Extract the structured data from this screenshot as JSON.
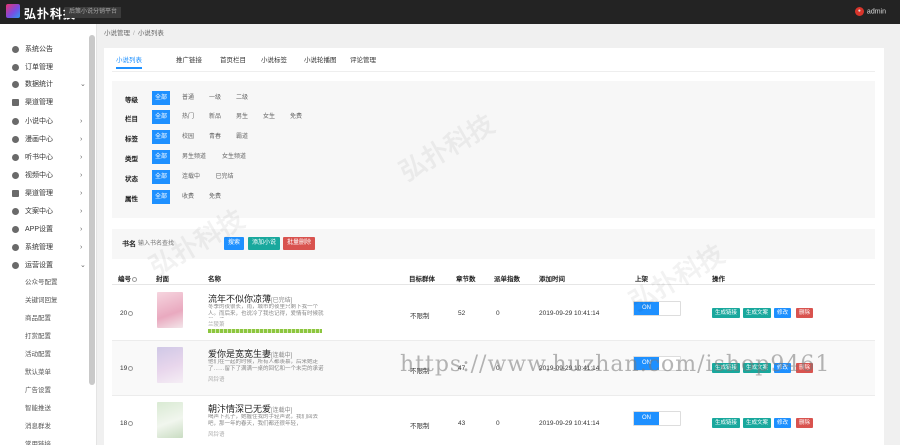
{
  "header": {
    "brand": "弘扑科技",
    "slogan": "后策小说分销平台",
    "user": "admin"
  },
  "sidebar": {
    "items": [
      {
        "label": "系统公告",
        "arrow": ""
      },
      {
        "label": "订单管理",
        "arrow": ""
      },
      {
        "label": "数据统计",
        "arrow": "⌄"
      },
      {
        "label": "渠道管理",
        "arrow": ""
      },
      {
        "label": "小说中心",
        "arrow": "›"
      },
      {
        "label": "漫画中心",
        "arrow": "›"
      },
      {
        "label": "听书中心",
        "arrow": "›"
      },
      {
        "label": "视频中心",
        "arrow": "›"
      },
      {
        "label": "渠道管理",
        "arrow": "›"
      },
      {
        "label": "文案中心",
        "arrow": "›"
      },
      {
        "label": "APP设置",
        "arrow": "›"
      },
      {
        "label": "系统管理",
        "arrow": "›"
      },
      {
        "label": "运营设置",
        "arrow": "⌄"
      }
    ],
    "subitems": [
      "公众号配置",
      "关键词回复",
      "商品配置",
      "打赏配置",
      "活动配置",
      "默认菜单",
      "广告设置",
      "智能推送",
      "消息群发",
      "常用链接"
    ]
  },
  "breadcrumb": {
    "root": "小说管理",
    "sep": "/",
    "current": "小说列表"
  },
  "tabs": [
    "小说列表",
    "推广链接",
    "首页栏目",
    "小说标签",
    "小说轮播图",
    "评论管理"
  ],
  "filters": [
    {
      "label": "等级",
      "options": [
        "全部",
        "普通",
        "一级",
        "二级"
      ]
    },
    {
      "label": "栏目",
      "options": [
        "全部",
        "热门",
        "新品",
        "男生",
        "女生",
        "免费"
      ]
    },
    {
      "label": "标签",
      "options": [
        "全部",
        "校园",
        "青春",
        "霸道"
      ]
    },
    {
      "label": "类型",
      "options": [
        "全部",
        "男生频道",
        "女生频道"
      ]
    },
    {
      "label": "状态",
      "options": [
        "全部",
        "连载中",
        "已完结"
      ]
    },
    {
      "label": "属性",
      "options": [
        "全部",
        "收费",
        "免费"
      ]
    }
  ],
  "search": {
    "label": "书名",
    "placeholder": "输入书名查找",
    "search_btn": "搜索",
    "add_btn": "添加小说",
    "delete_btn": "批量删除"
  },
  "table": {
    "headers": [
      "编号",
      "封面",
      "名称",
      "目标群体",
      "章节数",
      "派单指数",
      "添加时间",
      "上架",
      "操作"
    ],
    "rows": [
      {
        "id": "20",
        "title": "流年不似你凉薄",
        "status": "[已完结]",
        "desc": "冬季的夜很长，雨，城市的夜里只剩下我一个人。而后来，也说冷了我也记得，爱情有时候就是一场",
        "author": "兰陵萧",
        "target": "不限制",
        "chapters": "52",
        "index": "0",
        "time": "2019-09-29 10:41:14",
        "switch": "ON",
        "actions": [
          "生成链接",
          "生成文案",
          "修改",
          "删除"
        ]
      },
      {
        "id": "19",
        "title": "爱你是宽宽生妻",
        "status": "[连载中]",
        "desc": "他们在一起的时候，所有人都羡慕，后来她走了……留下了满满一桌的回忆和一个未完的承诺",
        "author": "风铃语",
        "target": "不限制",
        "chapters": "47",
        "index": "0",
        "time": "2019-09-29 10:41:14",
        "switch": "ON",
        "actions": [
          "生成链接",
          "生成文案",
          "修改",
          "删除"
        ]
      },
      {
        "id": "18",
        "title": "朝汴情深已无爱",
        "status": "[连载中]",
        "desc": "喝声下孔子，她握住我的手轻声说，我们回去吧，那一年的春天，我们都还很年轻，",
        "author": "风铃语",
        "target": "不限制",
        "chapters": "43",
        "index": "0",
        "time": "2019-09-29 10:41:14",
        "switch": "ON",
        "actions": [
          "生成链接",
          "生成文案",
          "修改",
          "删除"
        ]
      }
    ]
  },
  "watermarks": {
    "brand": "弘扑科技",
    "url": "https://www.huzhan.com/ishop9461"
  },
  "colors": {
    "primary": "#1e90ff",
    "teal": "#19a89d",
    "danger": "#d9534f",
    "topbar": "#232323"
  }
}
